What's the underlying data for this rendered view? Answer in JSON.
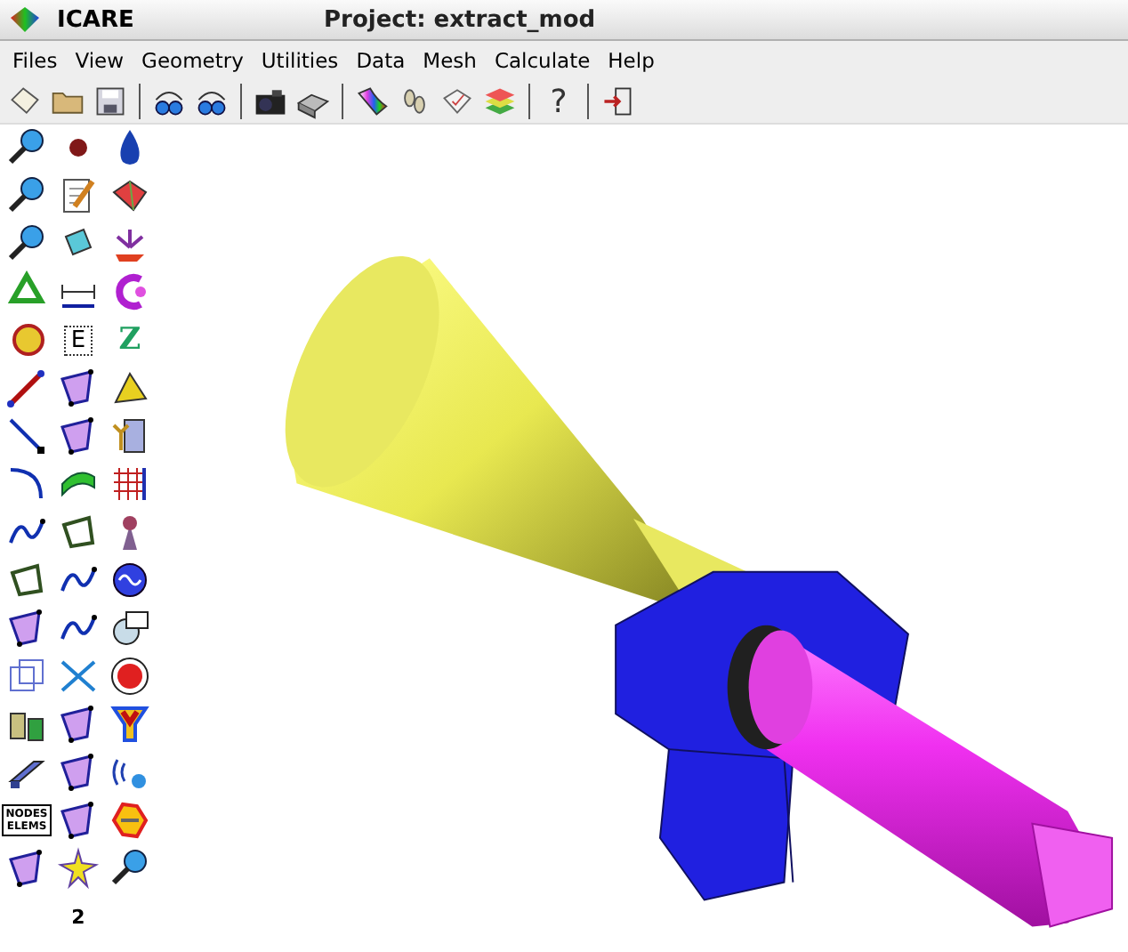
{
  "window": {
    "app_name": "ICARE",
    "title": "Project: extract_mod"
  },
  "menu": [
    "Files",
    "View",
    "Geometry",
    "Utilities",
    "Data",
    "Mesh",
    "Calculate",
    "Help"
  ],
  "toolbar": {
    "help_glyph": "?"
  },
  "tool_palette": {
    "labels": [
      "E",
      "Z",
      "NODES",
      "ELEMS",
      "2"
    ]
  }
}
